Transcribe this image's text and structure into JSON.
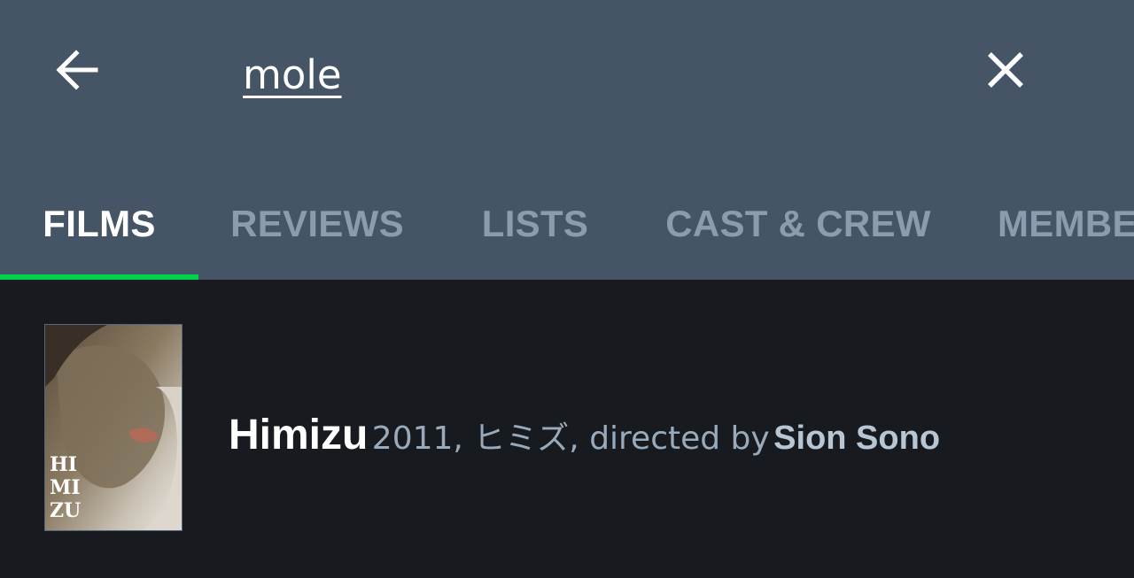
{
  "search": {
    "query": "mole"
  },
  "tabs": [
    {
      "label": "FILMS",
      "active": true
    },
    {
      "label": "REVIEWS",
      "active": false
    },
    {
      "label": "LISTS",
      "active": false
    },
    {
      "label": "CAST & CREW",
      "active": false
    },
    {
      "label": "MEMBE",
      "active": false
    }
  ],
  "results": [
    {
      "title": "Himizu",
      "meta": "2011, ヒミズ, directed by",
      "director": "Sion Sono",
      "poster_text": [
        "HI",
        "MI",
        "ZU"
      ]
    }
  ],
  "icons": {
    "back": "arrow-left-icon",
    "clear": "close-icon"
  },
  "colors": {
    "header_bg": "#455566",
    "page_bg": "#171b1f",
    "accent": "#00d34f",
    "inactive_tab": "#8a9cae"
  }
}
